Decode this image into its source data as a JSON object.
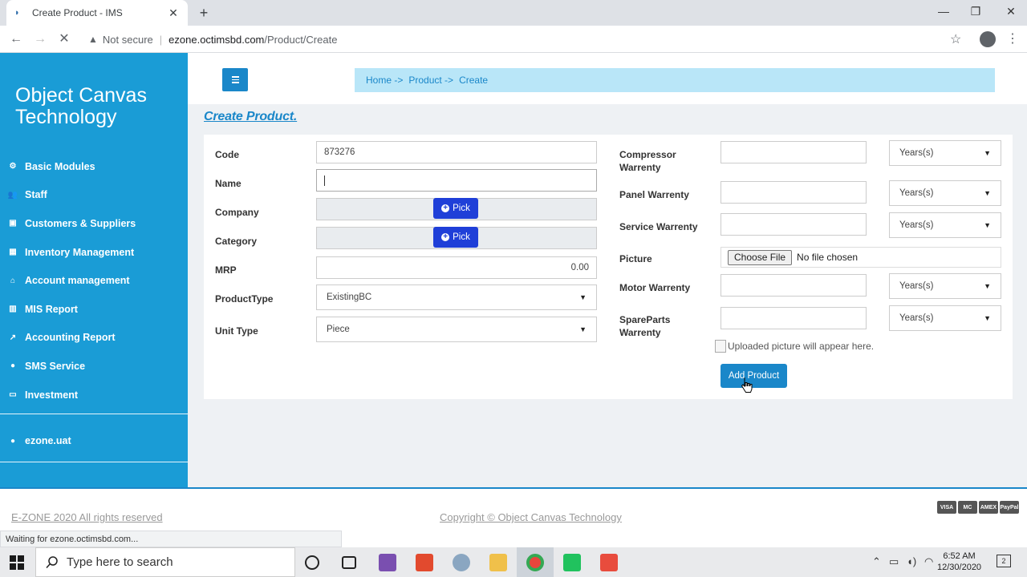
{
  "browser": {
    "tab_title": "Create Product - IMS",
    "not_secure": "Not secure",
    "url_domain": "ezone.octimsbd.com",
    "url_path": "/Product/Create",
    "status": "Waiting for ezone.octimsbd.com..."
  },
  "sidebar": {
    "brand": "Object Canvas Technology",
    "items": [
      {
        "label": "Basic Modules",
        "icon": "gear-icon"
      },
      {
        "label": "Staff",
        "icon": "users-icon"
      },
      {
        "label": "Customers & Suppliers",
        "icon": "id-card-icon"
      },
      {
        "label": "Inventory Management",
        "icon": "table-icon"
      },
      {
        "label": "Account management",
        "icon": "bank-icon"
      },
      {
        "label": "MIS Report",
        "icon": "bar-chart-icon"
      },
      {
        "label": "Accounting Report",
        "icon": "line-chart-icon"
      },
      {
        "label": "SMS Service",
        "icon": "comment-icon"
      },
      {
        "label": "Investment",
        "icon": "money-icon"
      }
    ],
    "user": "ezone.uat"
  },
  "breadcrumb": [
    "Home ->",
    "Product ->",
    "Create"
  ],
  "page_title": "Create Product.",
  "form_left": {
    "code_label": "Code",
    "code_value": "873276",
    "name_label": "Name",
    "name_value": "",
    "company_label": "Company",
    "category_label": "Category",
    "pick_label": "Pick",
    "mrp_label": "MRP",
    "mrp_value": "0.00",
    "product_type_label": "ProductType",
    "product_type_value": "ExistingBC",
    "unit_type_label": "Unit Type",
    "unit_type_value": "Piece"
  },
  "form_right": {
    "compressor_label": "Compressor Warrenty",
    "panel_label": "Panel Warrenty",
    "service_label": "Service Warrenty",
    "picture_label": "Picture",
    "motor_label": "Motor Warrenty",
    "spareparts_label": "SpareParts Warrenty",
    "years_option": "Years(s)",
    "choose_file": "Choose File",
    "no_file": "No file chosen",
    "uploaded_placeholder": "Uploaded picture will appear here.",
    "add_button": "Add Product"
  },
  "footer": {
    "left": "E-ZONE 2020 All rights reserved",
    "copyright": "Copyright © Object Canvas Technology",
    "cards": [
      "VISA",
      "MC",
      "AMEX",
      "PayPal"
    ]
  },
  "taskbar": {
    "search_placeholder": "Type here to search",
    "time": "6:52 AM",
    "date": "12/30/2020",
    "notification_count": "2"
  }
}
